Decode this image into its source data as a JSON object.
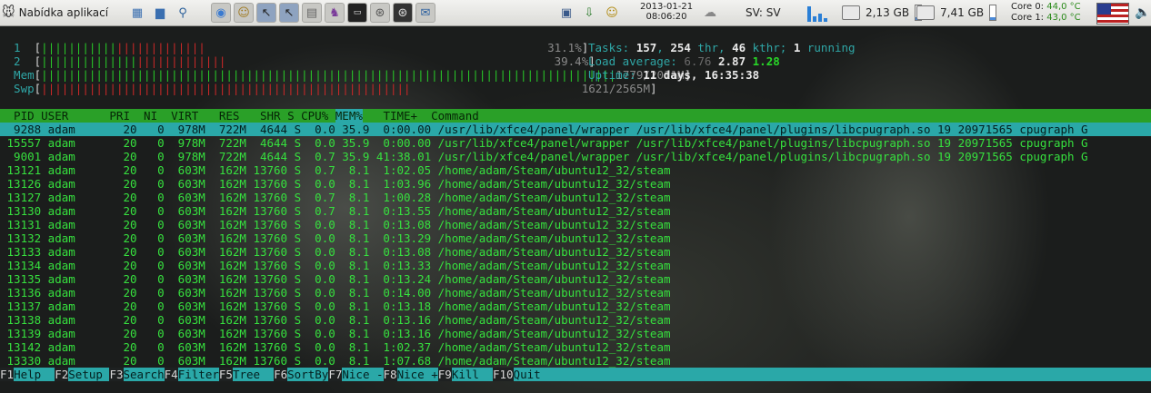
{
  "panel": {
    "app_menu_label": "Nabídka aplikací",
    "clock_date": "2013-01-21",
    "clock_time": "08:06:20",
    "keyboard_layout": "SV: SV",
    "memory_graph_levels": [
      0.85,
      0.3,
      0.45,
      0.2
    ],
    "disk1_free": "2,13 GB",
    "disk2_free": "7,41 GB",
    "core0_label": "Core 0: ",
    "core0_temp": "44,0 °C",
    "core1_label": "Core 1: ",
    "core1_temp": "43,0 °C",
    "launcher_icons": [
      "desktop-icon",
      "files-icon",
      "search-icon"
    ],
    "task_icons": [
      "chromium-icon",
      "gimp-icon",
      "window-icon",
      "window-icon",
      "document-icon",
      "app-icon",
      "terminal-icon",
      "steam-icon",
      "steam-icon",
      "thunderbird-icon"
    ],
    "tray_icons": [
      "network-icon",
      "update-icon",
      "smiley-icon"
    ]
  },
  "htop": {
    "meters": [
      {
        "label": "  1  ",
        "green": "|||||||||||",
        "red": "|||||||||||||",
        "pad": "                                                  ",
        "value": "31.1%"
      },
      {
        "label": "  2  ",
        "green": "||||||||||||||",
        "red": "|||||||||||||",
        "pad": "                                                ",
        "value": "39.4%"
      },
      {
        "label": "  Mem",
        "green": "||||||||||||||||||||||||||||||||||||||||||||||||||||||||||||||||||||||||||||||||||||",
        "red": "",
        "pad": "",
        "value": "1779/2011M"
      },
      {
        "label": "  Swp",
        "green": "",
        "red": "||||||||||||||||||||||||||||||||||||||||||||||||||||||",
        "pad": "                         ",
        "value": "1621/2565M"
      }
    ],
    "tasks_label": "Tasks: ",
    "tasks_total": "157",
    "threads": "254",
    "threads_label": " thr, ",
    "kthreads": "46",
    "kthreads_label": " kthr; ",
    "running": "1",
    "running_label": " running",
    "load_label": "Load average: ",
    "load_1": "6.76",
    "load_5": "2.87",
    "load_15": "1.28",
    "uptime_label": "Uptime: ",
    "uptime_value": "11 days, 16:35:38",
    "columns_before": "  PID USER      PRI  NI  VIRT   RES   SHR S CPU% ",
    "column_sorted": "MEM%",
    "columns_after": "   TIME+  Command",
    "rows": [
      "  9288 adam       20   0  978M  722M  4644 S  0.0 35.9  0:00.00 /usr/lib/xfce4/panel/wrapper /usr/lib/xfce4/panel/plugins/libcpugraph.so 19 20971565 cpugraph G",
      " 15557 adam       20   0  978M  722M  4644 S  0.0 35.9  0:00.00 /usr/lib/xfce4/panel/wrapper /usr/lib/xfce4/panel/plugins/libcpugraph.so 19 20971565 cpugraph G",
      "  9001 adam       20   0  978M  722M  4644 S  0.7 35.9 41:38.01 /usr/lib/xfce4/panel/wrapper /usr/lib/xfce4/panel/plugins/libcpugraph.so 19 20971565 cpugraph G",
      " 13121 adam       20   0  603M  162M 13760 S  0.7  8.1  1:02.05 /home/adam/Steam/ubuntu12_32/steam",
      " 13126 adam       20   0  603M  162M 13760 S  0.0  8.1  1:03.96 /home/adam/Steam/ubuntu12_32/steam",
      " 13127 adam       20   0  603M  162M 13760 S  0.7  8.1  1:00.28 /home/adam/Steam/ubuntu12_32/steam",
      " 13130 adam       20   0  603M  162M 13760 S  0.7  8.1  0:13.55 /home/adam/Steam/ubuntu12_32/steam",
      " 13131 adam       20   0  603M  162M 13760 S  0.0  8.1  0:13.08 /home/adam/Steam/ubuntu12_32/steam",
      " 13132 adam       20   0  603M  162M 13760 S  0.0  8.1  0:13.29 /home/adam/Steam/ubuntu12_32/steam",
      " 13133 adam       20   0  603M  162M 13760 S  0.0  8.1  0:13.08 /home/adam/Steam/ubuntu12_32/steam",
      " 13134 adam       20   0  603M  162M 13760 S  0.0  8.1  0:13.33 /home/adam/Steam/ubuntu12_32/steam",
      " 13135 adam       20   0  603M  162M 13760 S  0.0  8.1  0:13.24 /home/adam/Steam/ubuntu12_32/steam",
      " 13136 adam       20   0  603M  162M 13760 S  0.0  8.1  0:14.00 /home/adam/Steam/ubuntu12_32/steam",
      " 13137 adam       20   0  603M  162M 13760 S  0.0  8.1  0:13.18 /home/adam/Steam/ubuntu12_32/steam",
      " 13138 adam       20   0  603M  162M 13760 S  0.0  8.1  0:13.16 /home/adam/Steam/ubuntu12_32/steam",
      " 13139 adam       20   0  603M  162M 13760 S  0.0  8.1  0:13.16 /home/adam/Steam/ubuntu12_32/steam",
      " 13142 adam       20   0  603M  162M 13760 S  0.0  8.1  1:02.37 /home/adam/Steam/ubuntu12_32/steam",
      " 13330 adam       20   0  603M  162M 13760 S  0.0  8.1  1:07.68 /home/adam/Steam/ubuntu12_32/steam"
    ],
    "footer": [
      {
        "key": "F1",
        "label": "Help  "
      },
      {
        "key": "F2",
        "label": "Setup "
      },
      {
        "key": "F3",
        "label": "Search"
      },
      {
        "key": "F4",
        "label": "Filter"
      },
      {
        "key": "F5",
        "label": "Tree  "
      },
      {
        "key": "F6",
        "label": "SortBy"
      },
      {
        "key": "F7",
        "label": "Nice -"
      },
      {
        "key": "F8",
        "label": "Nice +"
      },
      {
        "key": "F9",
        "label": "Kill  "
      },
      {
        "key": "F10",
        "label": "Quit"
      }
    ]
  }
}
